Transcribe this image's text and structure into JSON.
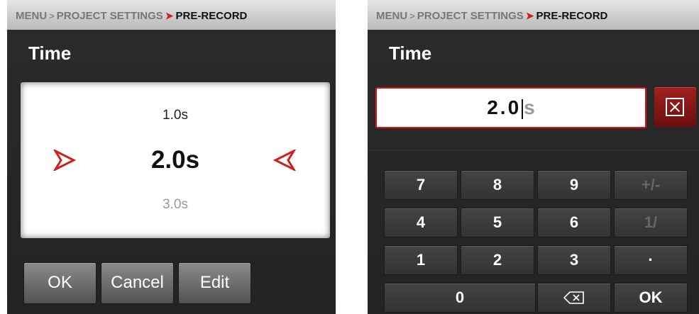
{
  "left": {
    "breadcrumb": {
      "menu": "MENU",
      "project_settings": "PROJECT SETTINGS",
      "current": "PRE-RECORD"
    },
    "title": "Time",
    "picker": {
      "prev": "1.0s",
      "selected": "2.0s",
      "next": "3.0s"
    },
    "buttons": {
      "ok": "OK",
      "cancel": "Cancel",
      "edit": "Edit"
    }
  },
  "right": {
    "breadcrumb": {
      "menu": "MENU",
      "project_settings": "PROJECT SETTINGS",
      "current": "PRE-RECORD"
    },
    "title": "Time",
    "entry": {
      "value": "2.0",
      "unit": "s"
    },
    "keys": {
      "k7": "7",
      "k8": "8",
      "k9": "9",
      "plusminus": "+/-",
      "k4": "4",
      "k5": "5",
      "k6": "6",
      "reciprocal": "1/",
      "k1": "1",
      "k2": "2",
      "k3": "3",
      "dot": "·",
      "k0": "0",
      "ok": "OK"
    }
  },
  "colors": {
    "accent_red": "#d11f1f",
    "panel_bg": "#262626",
    "breadcrumb_bg": "#cfcfcf"
  }
}
